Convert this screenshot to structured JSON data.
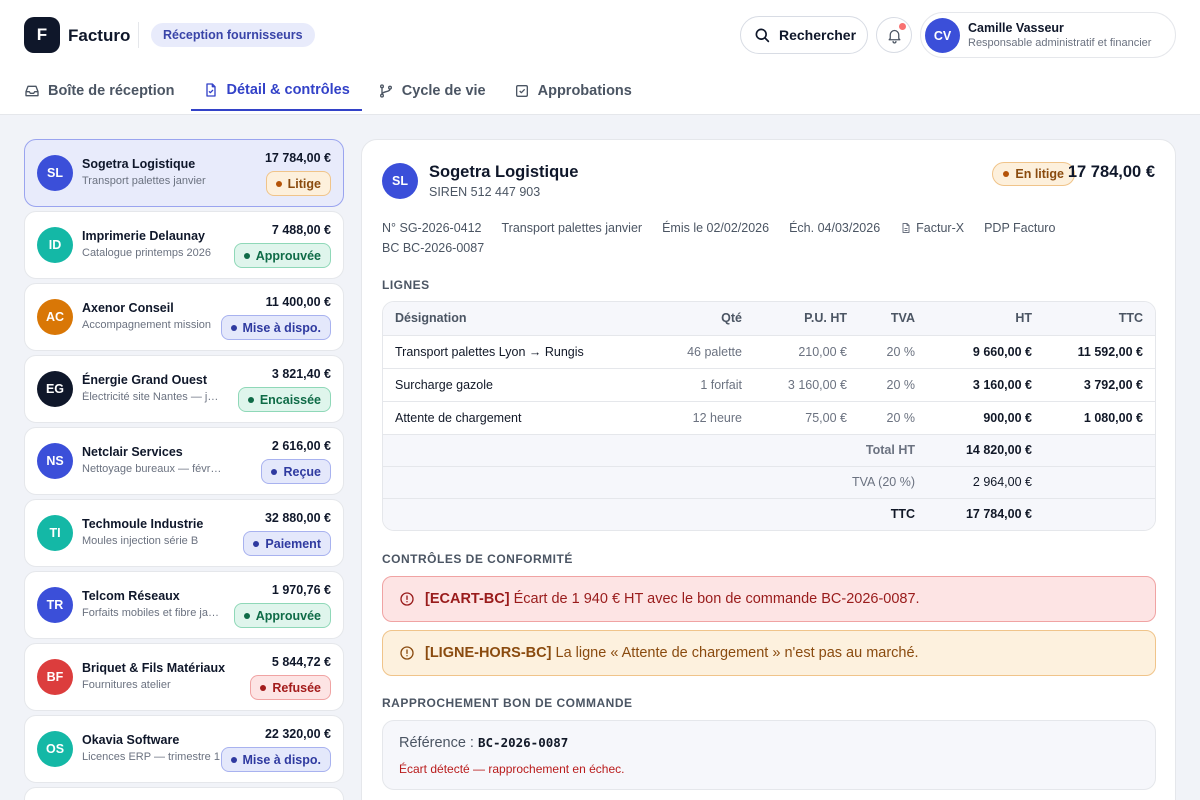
{
  "brand": {
    "logo_letter": "F",
    "name": "Facturo",
    "section": "Réception fournisseurs"
  },
  "header": {
    "search_label": "Rechercher",
    "user": {
      "initials": "CV",
      "name": "Camille Vasseur",
      "role": "Responsable administratif et financier",
      "avatar_color": "#3b4fd9"
    }
  },
  "tabs": [
    {
      "label": "Boîte de réception",
      "icon": "inbox-icon",
      "active": false
    },
    {
      "label": "Détail & contrôles",
      "icon": "document-icon",
      "active": true
    },
    {
      "label": "Cycle de vie",
      "icon": "branch-icon",
      "active": false
    },
    {
      "label": "Approbations",
      "icon": "checkbox-icon",
      "active": false
    }
  ],
  "invoices": [
    {
      "initials": "SL",
      "name": "Sogetra Logistique",
      "desc": "Transport palettes janvier",
      "amount": "17 784,00 €",
      "status": "Litige",
      "color": "#3b4fd9",
      "tone": "warn",
      "selected": true
    },
    {
      "initials": "ID",
      "name": "Imprimerie Delaunay",
      "desc": "Catalogue printemps 2026",
      "amount": "7 488,00 €",
      "status": "Approuvée",
      "color": "#14b8a6",
      "tone": "green",
      "selected": false
    },
    {
      "initials": "AC",
      "name": "Axenor Conseil",
      "desc": "Accompagnement mission",
      "amount": "11 400,00 €",
      "status": "Mise à dispo.",
      "color": "#d97706",
      "tone": "blue",
      "selected": false
    },
    {
      "initials": "EG",
      "name": "Énergie Grand Ouest",
      "desc": "Électricité site Nantes — janvier",
      "amount": "3 821,40 €",
      "status": "Encaissée",
      "color": "#0f172a",
      "tone": "green",
      "selected": false
    },
    {
      "initials": "NS",
      "name": "Netclair Services",
      "desc": "Nettoyage bureaux — février",
      "amount": "2 616,00 €",
      "status": "Reçue",
      "color": "#3b4fd9",
      "tone": "blue",
      "selected": false
    },
    {
      "initials": "TI",
      "name": "Techmoule Industrie",
      "desc": "Moules injection série B",
      "amount": "32 880,00 €",
      "status": "Paiement",
      "color": "#14b8a6",
      "tone": "blue",
      "selected": false
    },
    {
      "initials": "TR",
      "name": "Telcom Réseaux",
      "desc": "Forfaits mobiles et fibre janvier",
      "amount": "1 970,76 €",
      "status": "Approuvée",
      "color": "#3b4fd9",
      "tone": "green",
      "selected": false
    },
    {
      "initials": "BF",
      "name": "Briquet & Fils Matériaux",
      "desc": "Fournitures atelier",
      "amount": "5 844,72 €",
      "status": "Refusée",
      "color": "#dc3d3d",
      "tone": "red",
      "selected": false
    },
    {
      "initials": "OS",
      "name": "Okavia Software",
      "desc": "Licences ERP — trimestre 1",
      "amount": "22 320,00 €",
      "status": "Mise à dispo.",
      "color": "#14b8a6",
      "tone": "blue",
      "selected": false
    }
  ],
  "tones": {
    "warn": {
      "bg": "#fdf0dc",
      "border": "#f0c48a",
      "text": "#8a4b0f",
      "dot": "#b45309"
    },
    "green": {
      "bg": "#dff5ec",
      "border": "#8fd8b8",
      "text": "#0f6b47",
      "dot": "#0f6b47"
    },
    "blue": {
      "bg": "#e4e8fb",
      "border": "#a8b2ef",
      "text": "#2f3aa0",
      "dot": "#2f3aa0"
    },
    "red": {
      "bg": "#fde4e4",
      "border": "#f0a3a3",
      "text": "#a31b1b",
      "dot": "#a31b1b"
    }
  },
  "detail": {
    "initials": "SL",
    "supplier": "Sogetra Logistique",
    "siren": "SIREN 512 447 903",
    "status": "En litige",
    "total": "17 784,00 €",
    "meta": [
      "N° SG-2026-0412",
      "Transport palettes janvier",
      "Émis le 02/02/2026",
      "Éch. 04/03/2026",
      "Factur-X",
      "PDP Facturo",
      "BC BC-2026-0087"
    ],
    "lines_title": "LIGNES",
    "columns": [
      "Désignation",
      "Qté",
      "P.U. HT",
      "TVA",
      "HT",
      "TTC"
    ],
    "lines": [
      {
        "designation": "Transport palettes Lyon → Rungis",
        "qty": "46 palette",
        "unit": "210,00 €",
        "vat": "20 %",
        "ht": "9 660,00 €",
        "ttc": "11 592,00 €"
      },
      {
        "designation": "Surcharge gazole",
        "qty": "1 forfait",
        "unit": "3 160,00 €",
        "vat": "20 %",
        "ht": "3 160,00 €",
        "ttc": "3 792,00 €"
      },
      {
        "designation": "Attente de chargement",
        "qty": "12 heure",
        "unit": "75,00 €",
        "vat": "20 %",
        "ht": "900,00 €",
        "ttc": "1 080,00 €"
      }
    ],
    "totals": {
      "ht_label": "Total HT",
      "ht_value": "14 820,00 €",
      "vat_label": "TVA (20 %)",
      "vat_value": "2 964,00 €",
      "ttc_label": "TTC",
      "ttc_value": "17 784,00 €"
    },
    "controls_title": "CONTRÔLES DE CONFORMITÉ",
    "controls": [
      {
        "code": "[ECART-BC]",
        "text": "Écart de 1 940 € HT avec le bon de commande BC-2026-0087.",
        "tone": "error"
      },
      {
        "code": "[LIGNE-HORS-BC]",
        "text": "La ligne « Attente de chargement » n'est pas au marché.",
        "tone": "warn"
      }
    ],
    "matching_title": "RAPPROCHEMENT BON DE COMMANDE",
    "matching": {
      "ref_label": "Référence :",
      "ref_value": "BC-2026-0087",
      "message": "Écart détecté — rapprochement en échec."
    }
  }
}
